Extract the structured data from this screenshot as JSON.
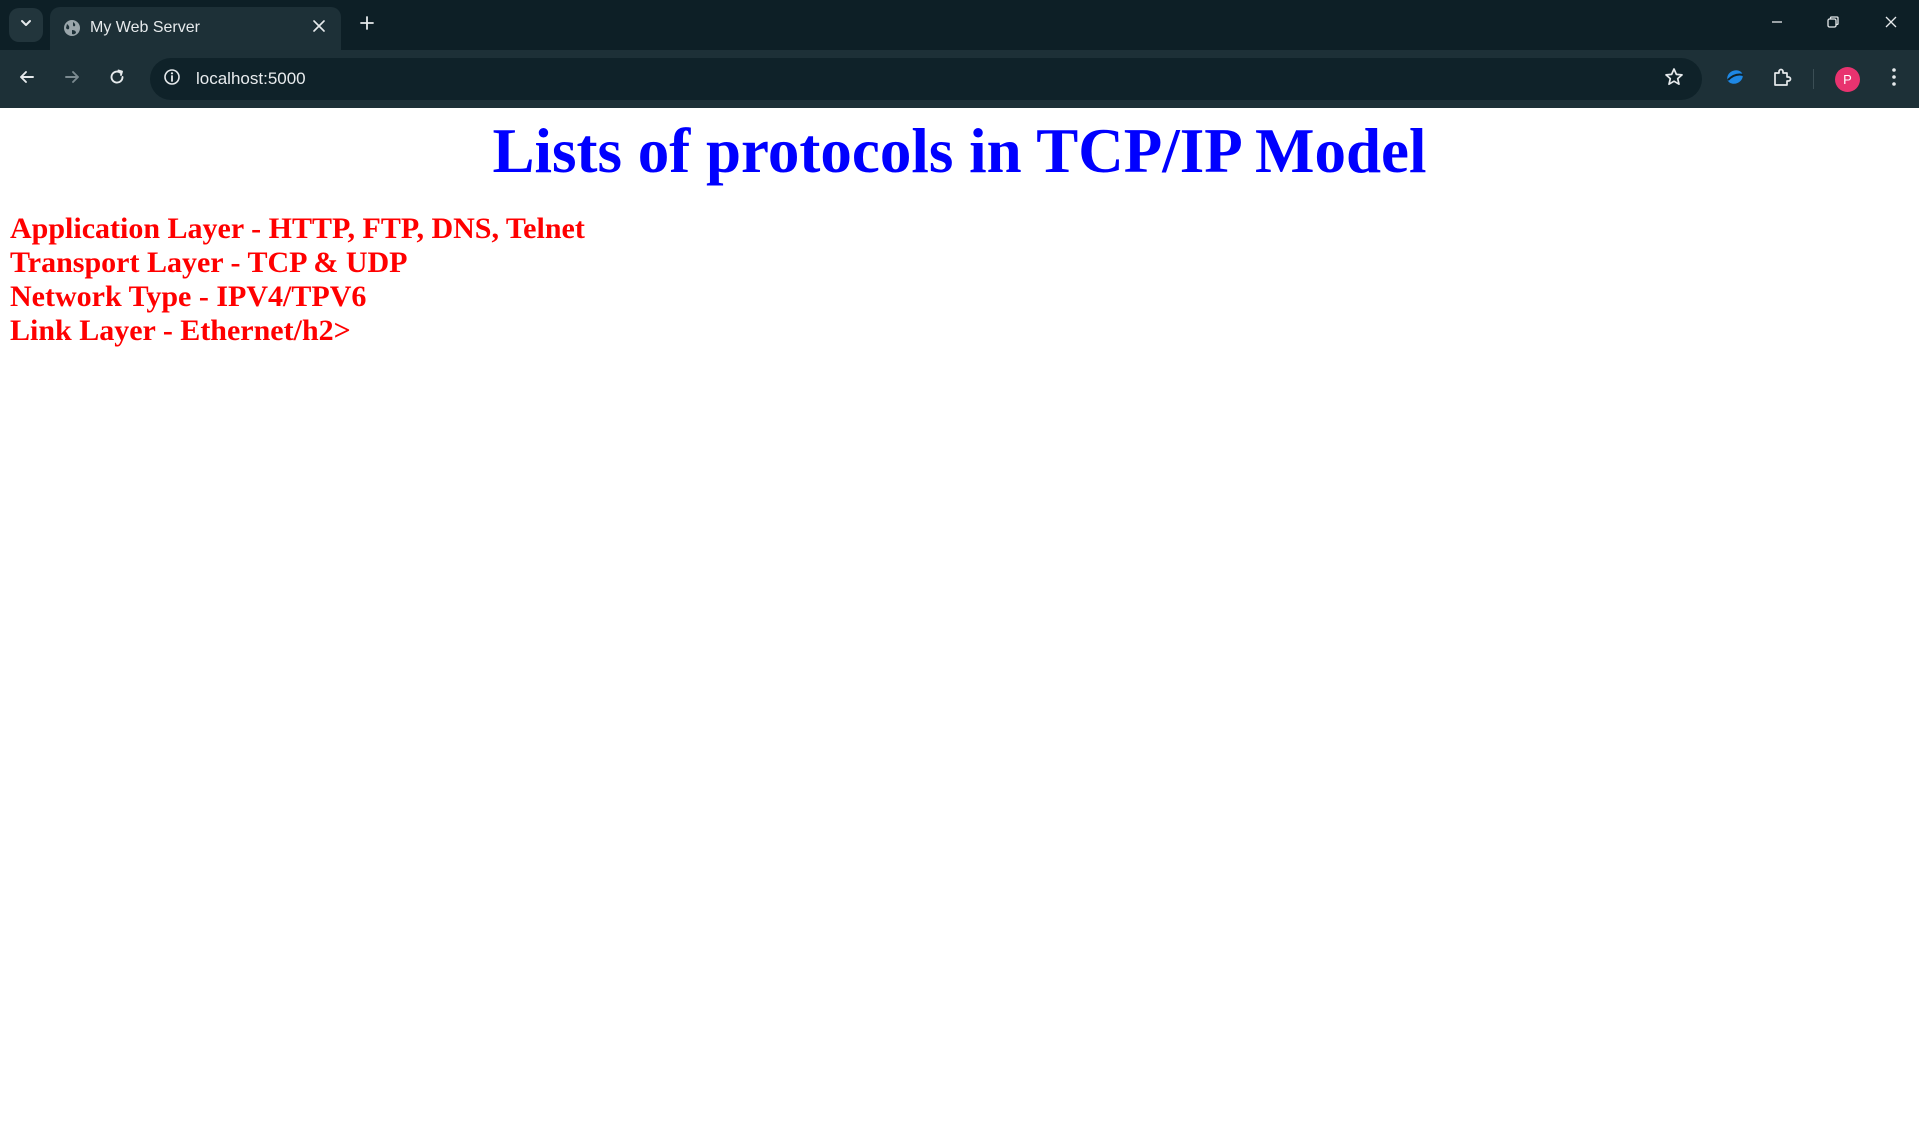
{
  "browser": {
    "tab": {
      "title": "My Web Server"
    },
    "address_bar": {
      "url": "localhost:5000"
    },
    "profile": {
      "initial": "P"
    },
    "colors": {
      "avatar": "#e8336f",
      "extension_accent": "#1e88e5"
    }
  },
  "page": {
    "title": "Lists of protocols in TCP/IP Model",
    "title_color": "#0000ff",
    "line_color": "#ff0000",
    "lines": [
      "Application Layer - HTTP, FTP, DNS, Telnet",
      "Transport Layer - TCP & UDP",
      "Network Type - IPV4/TPV6",
      "Link Layer - Ethernet/h2>"
    ]
  },
  "icons": [
    "tab-search-icon",
    "globe-icon",
    "close-icon",
    "plus-icon",
    "minimize-icon",
    "restore-icon",
    "window-close-icon",
    "back-arrow-icon",
    "forward-arrow-icon",
    "reload-icon",
    "info-icon",
    "star-icon",
    "extension-icon",
    "puzzle-icon",
    "kebab-menu-icon"
  ]
}
